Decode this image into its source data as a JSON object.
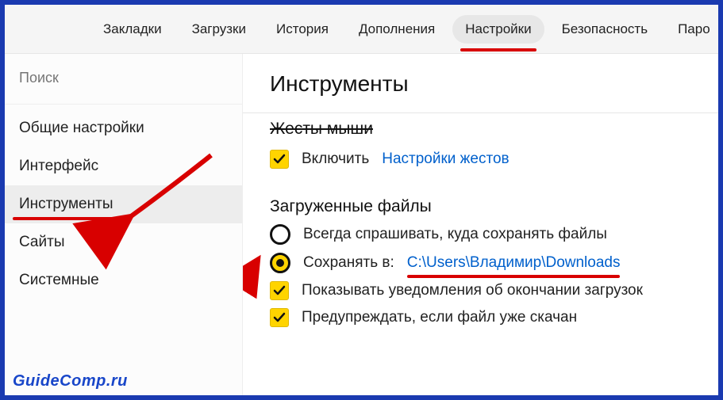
{
  "topnav": {
    "tabs": [
      {
        "label": "Закладки"
      },
      {
        "label": "Загрузки"
      },
      {
        "label": "История"
      },
      {
        "label": "Дополнения"
      },
      {
        "label": "Настройки",
        "active": true
      },
      {
        "label": "Безопасность"
      },
      {
        "label": "Паро"
      }
    ]
  },
  "sidebar": {
    "search_placeholder": "Поиск",
    "items": [
      {
        "label": "Общие настройки"
      },
      {
        "label": "Интерфейс"
      },
      {
        "label": "Инструменты",
        "selected": true
      },
      {
        "label": "Сайты"
      },
      {
        "label": "Системные"
      }
    ]
  },
  "content": {
    "title": "Инструменты",
    "mouse_gestures": {
      "heading": "Жесты мыши",
      "enable_label": "Включить",
      "settings_link": "Настройки жестов"
    },
    "downloads": {
      "heading": "Загруженные файлы",
      "always_ask": "Всегда спрашивать, куда сохранять файлы",
      "save_to_label": "Сохранять в:",
      "save_to_path": "C:\\Users\\Владимир\\Downloads",
      "show_notifications": "Показывать уведомления об окончании загрузок",
      "warn_downloaded": "Предупреждать, если файл уже скачан"
    }
  },
  "watermark": "GuideComp.ru"
}
